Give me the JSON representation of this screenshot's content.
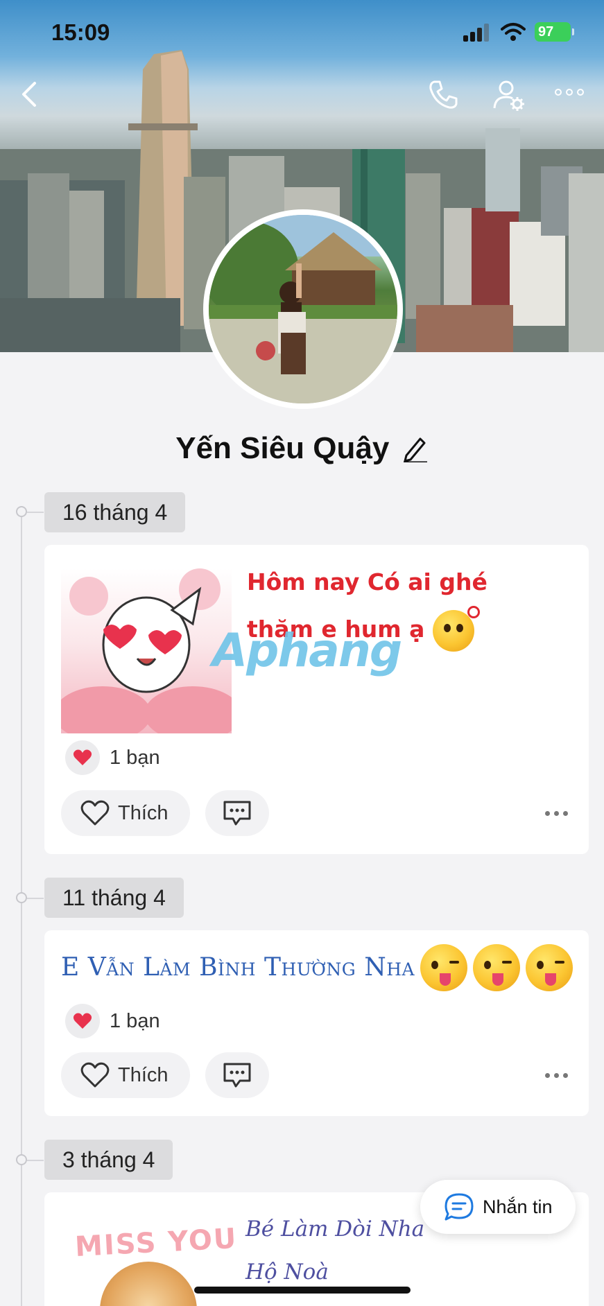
{
  "status_bar": {
    "time": "15:09",
    "battery": "97"
  },
  "profile": {
    "name": "Yến Siêu Quậy"
  },
  "watermark": "Aphang",
  "posts": [
    {
      "date": "16 tháng 4",
      "text_line1": "Hôm nay Có ai ghé",
      "text_line2": "thăm e hum ạ",
      "reaction_count": "1 bạn",
      "like_label": "Thích"
    },
    {
      "date": "11 tháng 4",
      "text": "E Vẫn Làm Bình Thường Nha",
      "reaction_count": "1 bạn",
      "like_label": "Thích"
    },
    {
      "date": "3 tháng 4",
      "sticker_text": "MISS YOU",
      "text_line1": "Bé Làm Dòi Nha",
      "text_line2": "Hộ Noà"
    }
  ],
  "message_button": {
    "label": "Nhắn tin"
  },
  "icons": {
    "back": "chevron-left-icon",
    "call": "phone-icon",
    "profile_settings": "user-gear-icon",
    "more": "more-horizontal-icon",
    "edit": "pencil-icon",
    "heart": "heart-icon",
    "comment": "comment-icon",
    "message": "chat-bubble-icon"
  },
  "colors": {
    "accent": "#1e7ae0",
    "post_red": "#e0272f",
    "post_blue": "#2f5fb3",
    "heart": "#e8324d",
    "battery": "#3bcf5a"
  }
}
